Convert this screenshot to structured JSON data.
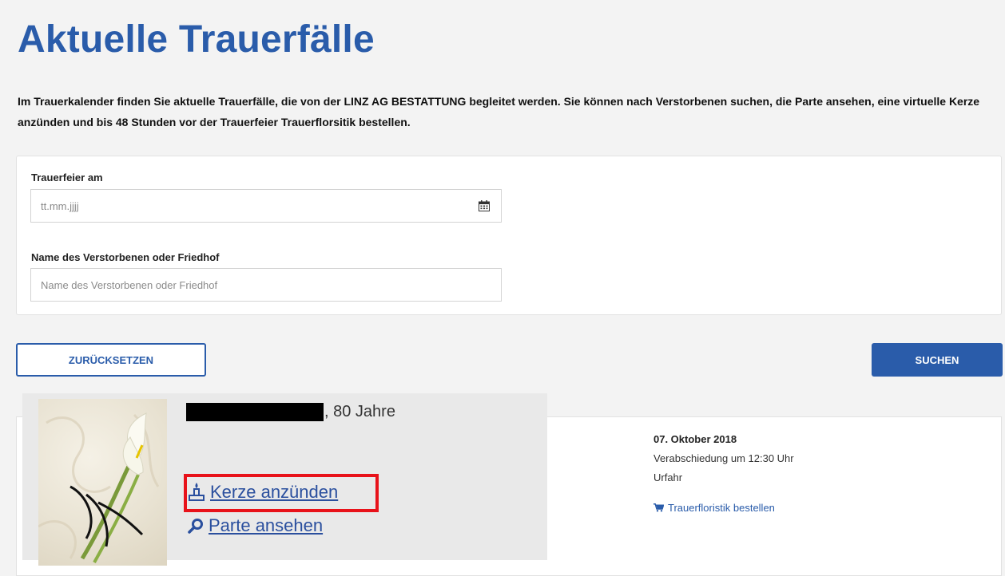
{
  "page": {
    "title": "Aktuelle Trauerfälle",
    "intro": "Im Trauerkalender finden Sie aktuelle Trauerfälle, die von der LINZ AG BESTATTUNG begleitet werden. Sie können nach Verstorbenen suchen, die Parte ansehen, eine virtuelle Kerze anzünden und bis 48 Stunden vor der Trauerfeier Trauerflorsitik bestellen."
  },
  "search": {
    "date_label": "Trauerfeier am",
    "date_placeholder": "tt.mm.jjjj",
    "name_label": "Name des Verstorbenen oder Friedhof",
    "name_placeholder": "Name des Verstorbenen oder Friedhof",
    "reset_label": "ZURÜCKSETZEN",
    "search_label": "SUCHEN"
  },
  "result": {
    "age": ", 80 Jahre",
    "date": "07. Oktober 2018",
    "time": "Verabschiedung um 12:30 Uhr",
    "location": "Urfahr",
    "floristik_label": "Trauerfloristik bestellen",
    "candle_label": "Kerze anzünden",
    "parte_label": "Parte ansehen"
  },
  "colors": {
    "brand": "#2a5caa",
    "highlight": "#e8121a"
  },
  "icons": {
    "date": "calendar-icon",
    "floristik": "cart-icon",
    "candle": "candle-icon",
    "parte": "magnifier-icon"
  }
}
